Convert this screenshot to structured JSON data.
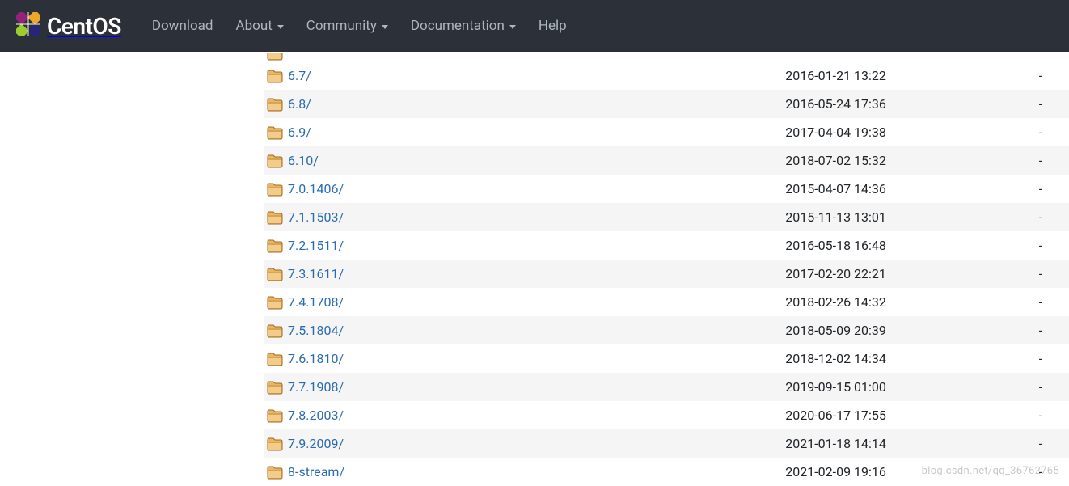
{
  "brand": {
    "name": "CentOS"
  },
  "nav": {
    "download": "Download",
    "about": "About",
    "community": "Community",
    "docs": "Documentation",
    "help": "Help"
  },
  "listing": {
    "rows": [
      {
        "name": "6.7/",
        "date": "2016-01-21 13:22",
        "size": "-"
      },
      {
        "name": "6.8/",
        "date": "2016-05-24 17:36",
        "size": "-"
      },
      {
        "name": "6.9/",
        "date": "2017-04-04 19:38",
        "size": "-"
      },
      {
        "name": "6.10/",
        "date": "2018-07-02 15:32",
        "size": "-"
      },
      {
        "name": "7.0.1406/",
        "date": "2015-04-07 14:36",
        "size": "-"
      },
      {
        "name": "7.1.1503/",
        "date": "2015-11-13 13:01",
        "size": "-"
      },
      {
        "name": "7.2.1511/",
        "date": "2016-05-18 16:48",
        "size": "-"
      },
      {
        "name": "7.3.1611/",
        "date": "2017-02-20 22:21",
        "size": "-"
      },
      {
        "name": "7.4.1708/",
        "date": "2018-02-26 14:32",
        "size": "-"
      },
      {
        "name": "7.5.1804/",
        "date": "2018-05-09 20:39",
        "size": "-"
      },
      {
        "name": "7.6.1810/",
        "date": "2018-12-02 14:34",
        "size": "-"
      },
      {
        "name": "7.7.1908/",
        "date": "2019-09-15 01:00",
        "size": "-"
      },
      {
        "name": "7.8.2003/",
        "date": "2020-06-17 17:55",
        "size": "-"
      },
      {
        "name": "7.9.2009/",
        "date": "2021-01-18 14:14",
        "size": "-"
      },
      {
        "name": "8-stream/",
        "date": "2021-02-09 19:16",
        "size": "-"
      }
    ]
  },
  "watermark": "blog.csdn.net/qq_36762765"
}
